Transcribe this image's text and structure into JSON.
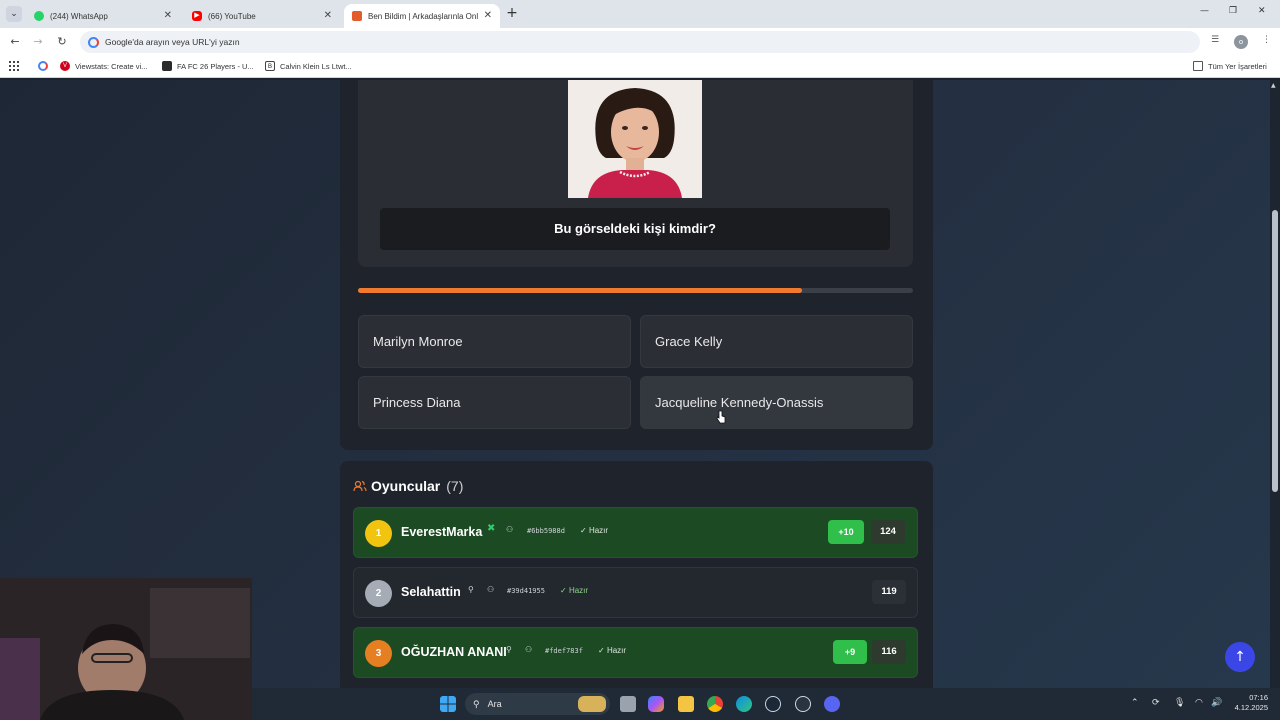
{
  "browser": {
    "tabs": [
      {
        "label": "(244) WhatsApp",
        "favicon": "whatsapp-icon",
        "color": "#25d366"
      },
      {
        "label": "(66) YouTube",
        "favicon": "youtube-icon",
        "color": "#ff0000"
      },
      {
        "label": "Ben Bildim | Arkadaşlarınla Onl",
        "favicon": "site-icon",
        "color": "#e25d2a",
        "active": true
      }
    ],
    "address_placeholder": "Google'da arayın veya URL'yi yazın",
    "bookmarks": [
      {
        "label": "Viewstats: Create vi...",
        "color": "#d0021b"
      },
      {
        "label": "FA FC 26 Players - U...",
        "color": "#2b2b2b"
      },
      {
        "label": "Calvin Klein Ls Ltwt...",
        "color": "#444444"
      }
    ],
    "all_bookmarks_label": "Tüm Yer İşaretleri",
    "profile_initial": "o"
  },
  "question": {
    "image_alt": "Jacqueline Kennedy-Onassis portrait",
    "text": "Bu görseldeki kişi kimdir?",
    "timer_fraction": 0.8
  },
  "answers": [
    {
      "label": "Marilyn Monroe"
    },
    {
      "label": "Grace Kelly"
    },
    {
      "label": "Princess Diana"
    },
    {
      "label": "Jacqueline Kennedy-Onassis"
    }
  ],
  "players": {
    "title": "Oyuncular",
    "count": "(7)",
    "list": [
      {
        "rank": "1",
        "name": "EverestMarka",
        "id": "#6bb5988d",
        "status": "Hazır",
        "delta": "+10",
        "score": "124",
        "rank_color": "#f1c40f",
        "highlight": true
      },
      {
        "rank": "2",
        "name": "Selahattin",
        "id": "#39d41955",
        "status": "Hazır",
        "delta": "",
        "score": "119",
        "rank_color": "#a5acb5",
        "highlight": false
      },
      {
        "rank": "3",
        "name": "OĞUZHAN ANANI",
        "id": "#fdef783f",
        "status": "Hazır",
        "delta": "+9",
        "score": "116",
        "rank_color": "#e67e22",
        "highlight": true
      }
    ]
  },
  "taskbar": {
    "search_label": "Ara",
    "time": "07:16",
    "date": "4.12.2025"
  },
  "colors": {
    "accent_orange": "#f07b2e",
    "accent_green": "#2fbf4a",
    "fab_blue": "#3b46e6"
  }
}
